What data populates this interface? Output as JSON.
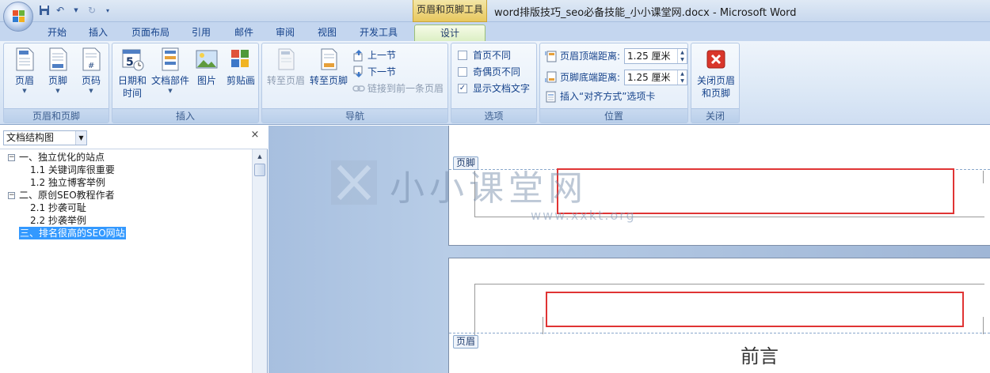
{
  "window": {
    "title": "word排版技巧_seo必备技能_小小课堂网.docx - Microsoft Word",
    "context_tab_title": "页眉和页脚工具"
  },
  "tabs": [
    {
      "label": "开始"
    },
    {
      "label": "插入"
    },
    {
      "label": "页面布局"
    },
    {
      "label": "引用"
    },
    {
      "label": "邮件"
    },
    {
      "label": "审阅"
    },
    {
      "label": "视图"
    },
    {
      "label": "开发工具"
    },
    {
      "label": "设计"
    }
  ],
  "ribbon": {
    "groups": {
      "header_footer": {
        "label": "页眉和页脚",
        "header": "页眉",
        "footer": "页脚",
        "page_number": "页码"
      },
      "insert": {
        "label": "插入",
        "datetime_line1": "日期和",
        "datetime_line2": "时间",
        "quick_parts": "文档部件",
        "picture": "图片",
        "clipart": "剪贴画"
      },
      "navigation": {
        "label": "导航",
        "goto_header": "转至页眉",
        "goto_footer": "转至页脚",
        "previous": "上一节",
        "next": "下一节",
        "link_previous": "链接到前一条页眉"
      },
      "options": {
        "label": "选项",
        "first_page": "首页不同",
        "odd_even": "奇偶页不同",
        "show_text": "显示文档文字"
      },
      "position": {
        "label": "位置",
        "header_from_top": "页眉顶端距离:",
        "header_value": "1.25 厘米",
        "footer_from_bottom": "页脚底端距离:",
        "footer_value": "1.25 厘米",
        "insert_alignment_tab": "插入“对齐方式”选项卡"
      },
      "close": {
        "label": "关闭",
        "close_line1": "关闭页眉",
        "close_line2": "和页脚"
      }
    },
    "checkboxes": {
      "first_page": false,
      "odd_even": false,
      "show_text": true
    }
  },
  "docmap": {
    "select": "文档结构图",
    "close": "×",
    "nodes": [
      {
        "label": "一、独立优化的站点",
        "expander": "−"
      },
      {
        "label": "1.1 关键词库很重要"
      },
      {
        "label": "1.2 独立博客举例"
      },
      {
        "label": "二、原创SEO教程作者",
        "expander": "−"
      },
      {
        "label": "2.1 抄袭可耻"
      },
      {
        "label": "2.2 抄袭举例"
      },
      {
        "label": "三、排名很高的SEO网站",
        "selected": true
      }
    ]
  },
  "document": {
    "footer_tag": "页脚",
    "header_tag": "页眉",
    "preface": "前言"
  },
  "watermark": {
    "text": "小小课堂网",
    "url": "www.xxkt.org"
  },
  "colors": {
    "accent": "#15428b",
    "red_highlight": "#e03434",
    "selection": "#3399ff"
  }
}
